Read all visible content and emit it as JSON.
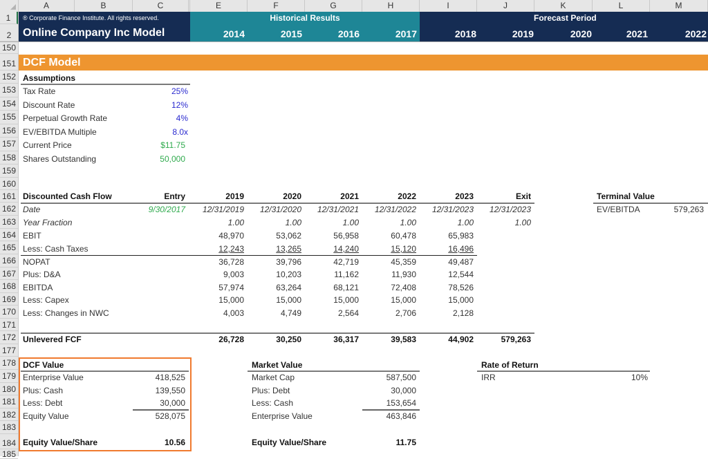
{
  "columns": [
    "A",
    "B",
    "C",
    "E",
    "F",
    "G",
    "H",
    "I",
    "J",
    "K",
    "L",
    "M"
  ],
  "row_numbers": [
    "1",
    "2",
    "150",
    "151",
    "152",
    "153",
    "154",
    "155",
    "156",
    "157",
    "158",
    "159",
    "160",
    "161",
    "162",
    "163",
    "164",
    "165",
    "166",
    "167",
    "168",
    "169",
    "170",
    "171",
    "172",
    "177",
    "178",
    "179",
    "180",
    "181",
    "182",
    "183",
    "184",
    "185"
  ],
  "banner": {
    "copyright": "® Corporate Finance Institute. All rights reserved.",
    "model_title": "Online Company Inc Model",
    "historical_label": "Historical Results",
    "forecast_label": "Forecast Period",
    "historical_years": [
      "2014",
      "2015",
      "2016",
      "2017"
    ],
    "forecast_years": [
      "2018",
      "2019",
      "2020",
      "2021",
      "2022"
    ],
    "colors": {
      "navy": "#152c53",
      "teal": "#1e8696",
      "orange": "#ee9530"
    }
  },
  "section_title": "DCF Model",
  "assumptions": {
    "heading": "Assumptions",
    "items": [
      {
        "label": "Tax Rate",
        "value": "25%",
        "kind": "input"
      },
      {
        "label": "Discount Rate",
        "value": "12%",
        "kind": "input"
      },
      {
        "label": "Perpetual Growth Rate",
        "value": "4%",
        "kind": "input"
      },
      {
        "label": "EV/EBITDA Multiple",
        "value": "8.0x",
        "kind": "input"
      },
      {
        "label": "Current Price",
        "value": "$11.75",
        "kind": "link"
      },
      {
        "label": "Shares Outstanding",
        "value": "50,000",
        "kind": "link"
      }
    ]
  },
  "dcf": {
    "heading": "Discounted Cash Flow",
    "column_headers": [
      "Entry",
      "2019",
      "2020",
      "2021",
      "2022",
      "2023",
      "Exit"
    ],
    "date_label": "Date",
    "dates": [
      "9/30/2017",
      "12/31/2019",
      "12/31/2020",
      "12/31/2021",
      "12/31/2022",
      "12/31/2023",
      "12/31/2023"
    ],
    "year_fraction_label": "Year Fraction",
    "year_fractions": [
      "",
      "1.00",
      "1.00",
      "1.00",
      "1.00",
      "1.00",
      "1.00"
    ],
    "rows": [
      {
        "label": "EBIT",
        "values": [
          "48,970",
          "53,062",
          "56,958",
          "60,478",
          "65,983"
        ]
      },
      {
        "label": "Less: Cash Taxes",
        "values": [
          "12,243",
          "13,265",
          "14,240",
          "15,120",
          "16,496"
        ]
      },
      {
        "label": "NOPAT",
        "values": [
          "36,728",
          "39,796",
          "42,719",
          "45,359",
          "49,487"
        ]
      },
      {
        "label": "Plus: D&A",
        "values": [
          "9,003",
          "10,203",
          "11,162",
          "11,930",
          "12,544"
        ]
      },
      {
        "label": "EBITDA",
        "values": [
          "57,974",
          "63,264",
          "68,121",
          "72,408",
          "78,526"
        ]
      },
      {
        "label": "Less: Capex",
        "values": [
          "15,000",
          "15,000",
          "15,000",
          "15,000",
          "15,000"
        ]
      },
      {
        "label": "Less: Changes in NWC",
        "values": [
          "4,003",
          "4,749",
          "2,564",
          "2,706",
          "2,128"
        ]
      }
    ],
    "total": {
      "label": "Unlevered FCF",
      "values": [
        "26,728",
        "30,250",
        "36,317",
        "39,583",
        "44,902"
      ],
      "exit": "579,263"
    }
  },
  "terminal_value": {
    "heading": "Terminal Value",
    "label": "EV/EBITDA",
    "value": "579,263"
  },
  "dcf_value": {
    "heading": "DCF Value",
    "rows": [
      {
        "label": "Enterprise Value",
        "value": "418,525"
      },
      {
        "label": "Plus: Cash",
        "value": "139,550"
      },
      {
        "label": "Less: Debt",
        "value": "30,000"
      },
      {
        "label": "Equity Value",
        "value": "528,075"
      }
    ],
    "per_share_label": "Equity Value/Share",
    "per_share_value": "10.56",
    "highlight_color": "#f07a2e"
  },
  "market_value": {
    "heading": "Market Value",
    "rows": [
      {
        "label": "Market Cap",
        "value": "587,500"
      },
      {
        "label": "Plus: Debt",
        "value": "30,000"
      },
      {
        "label": "Less: Cash",
        "value": "153,654"
      },
      {
        "label": "Enterprise Value",
        "value": "463,846"
      }
    ],
    "per_share_label": "Equity Value/Share",
    "per_share_value": "11.75"
  },
  "rate_of_return": {
    "heading": "Rate of Return",
    "label": "IRR",
    "value": "10%"
  }
}
